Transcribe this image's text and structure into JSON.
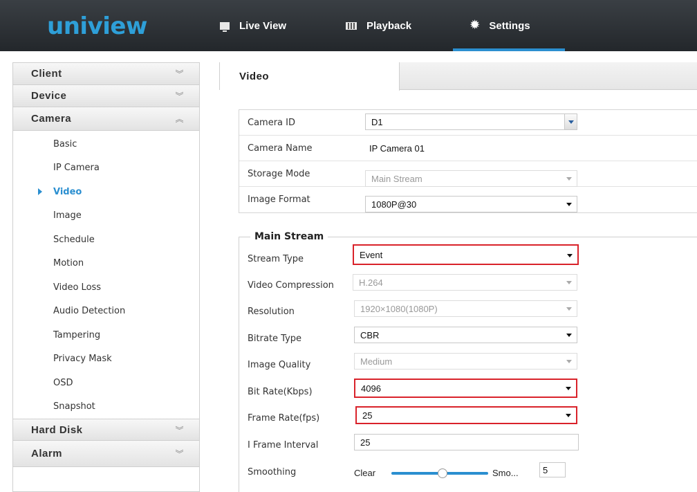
{
  "brand": {
    "logo": "uniview"
  },
  "nav": {
    "live_view": "Live View",
    "playback": "Playback",
    "settings": "Settings"
  },
  "sidebar": {
    "sections": [
      {
        "label": "Client",
        "state": "collapsed"
      },
      {
        "label": "Device",
        "state": "collapsed"
      },
      {
        "label": "Camera",
        "state": "expanded"
      }
    ],
    "camera_items": [
      "Basic",
      "IP Camera",
      "Video",
      "Image",
      "Schedule",
      "Motion",
      "Video Loss",
      "Audio Detection",
      "Tampering",
      "Privacy Mask",
      "OSD",
      "Snapshot"
    ],
    "active_item": "Video",
    "after_sections": [
      {
        "label": "Hard Disk",
        "state": "collapsed"
      },
      {
        "label": "Alarm",
        "state": "collapsed"
      }
    ]
  },
  "main": {
    "tab": "Video",
    "camera_id": {
      "label": "Camera ID",
      "value": "D1"
    },
    "camera_name": {
      "label": "Camera Name",
      "value": "IP Camera 01"
    },
    "storage_mode": {
      "label": "Storage Mode",
      "value": "Main Stream"
    },
    "image_format": {
      "label": "Image Format",
      "value": "1080P@30"
    },
    "main_stream": {
      "legend": "Main Stream",
      "stream_type": {
        "label": "Stream Type",
        "value": "Event"
      },
      "video_compression": {
        "label": "Video Compression",
        "value": "H.264"
      },
      "resolution": {
        "label": "Resolution",
        "value": "1920×1080(1080P)"
      },
      "bitrate_type": {
        "label": "Bitrate Type",
        "value": "CBR"
      },
      "image_quality": {
        "label": "Image Quality",
        "value": "Medium"
      },
      "bit_rate": {
        "label": "Bit Rate(Kbps)",
        "value": "4096"
      },
      "frame_rate": {
        "label": "Frame Rate(fps)",
        "value": "25"
      },
      "i_frame_interval": {
        "label": "I Frame Interval",
        "value": "25"
      },
      "smoothing": {
        "label": "Smoothing",
        "left": "Clear",
        "right": "Smo...",
        "value": "5",
        "level_fraction": 0.5
      }
    }
  },
  "colors": {
    "accent": "#2b8fd0",
    "highlight": "#d9222a",
    "topbar": "#2d3236"
  }
}
